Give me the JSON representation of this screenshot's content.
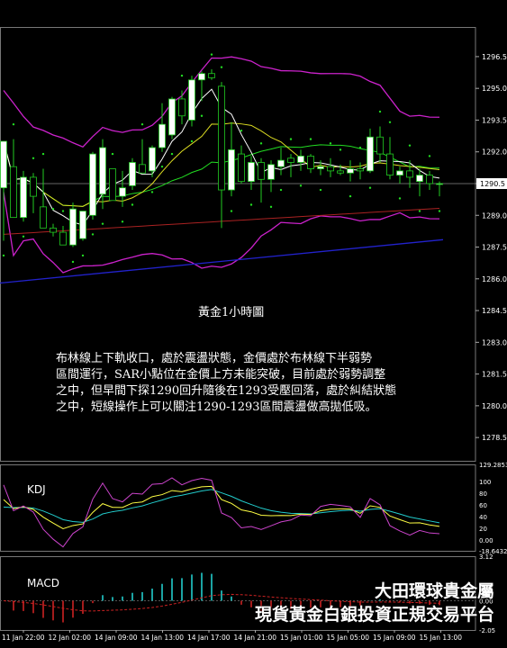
{
  "chart_data": [
    {
      "type": "candlestick",
      "title": "黃金1小時圖",
      "y_ticks": [
        1296.5,
        1295.0,
        1293.5,
        1292.0,
        1290.5,
        1289.0,
        1287.5,
        1286.0,
        1284.5,
        1283.0,
        1281.5,
        1280.0,
        1278.5
      ],
      "ylim": [
        1277.4,
        1297.9
      ],
      "current_price": "1290.5",
      "x_labels": [
        "11 Jan 22:00",
        "12 Jan 02:00",
        "14 Jan 09:00",
        "14 Jan 13:00",
        "14 Jan 17:00",
        "14 Jan 21:00",
        "15 Jan 01:00",
        "15 Jan 05:00",
        "15 Jan 09:00",
        "15 Jan 13:00"
      ],
      "candles": [
        {
          "o": 1290.3,
          "h": 1292.2,
          "l": 1287.8,
          "c": 1292.5
        },
        {
          "o": 1291.3,
          "h": 1292.6,
          "l": 1288.9,
          "c": 1288.9
        },
        {
          "o": 1288.9,
          "h": 1291.1,
          "l": 1288.7,
          "c": 1290.8
        },
        {
          "o": 1290.8,
          "h": 1291.0,
          "l": 1289.1,
          "c": 1289.9
        },
        {
          "o": 1289.4,
          "h": 1291.2,
          "l": 1288.4,
          "c": 1288.4
        },
        {
          "o": 1288.4,
          "h": 1288.6,
          "l": 1288.0,
          "c": 1288.2
        },
        {
          "o": 1288.2,
          "h": 1288.5,
          "l": 1287.6,
          "c": 1287.6
        },
        {
          "o": 1287.6,
          "h": 1289.6,
          "l": 1287.5,
          "c": 1289.3
        },
        {
          "o": 1287.9,
          "h": 1289.1,
          "l": 1287.8,
          "c": 1289.2
        },
        {
          "o": 1289.0,
          "h": 1292.0,
          "l": 1288.8,
          "c": 1291.9
        },
        {
          "o": 1290.0,
          "h": 1292.6,
          "l": 1289.3,
          "c": 1292.2
        },
        {
          "o": 1291.2,
          "h": 1291.2,
          "l": 1289.7,
          "c": 1289.7
        },
        {
          "o": 1289.9,
          "h": 1291.1,
          "l": 1289.4,
          "c": 1290.3
        },
        {
          "o": 1290.4,
          "h": 1291.7,
          "l": 1290.2,
          "c": 1291.5
        },
        {
          "o": 1291.4,
          "h": 1292.6,
          "l": 1291.0,
          "c": 1291.0
        },
        {
          "o": 1291.1,
          "h": 1292.3,
          "l": 1290.8,
          "c": 1292.2
        },
        {
          "o": 1292.2,
          "h": 1294.3,
          "l": 1292.0,
          "c": 1293.3
        },
        {
          "o": 1292.8,
          "h": 1294.6,
          "l": 1292.6,
          "c": 1294.5
        },
        {
          "o": 1294.5,
          "h": 1294.9,
          "l": 1293.3,
          "c": 1293.7
        },
        {
          "o": 1293.5,
          "h": 1295.6,
          "l": 1293.2,
          "c": 1295.4
        },
        {
          "o": 1295.4,
          "h": 1295.8,
          "l": 1294.4,
          "c": 1295.7
        },
        {
          "o": 1295.7,
          "h": 1295.9,
          "l": 1295.4,
          "c": 1295.5
        },
        {
          "o": 1295.1,
          "h": 1295.3,
          "l": 1288.4,
          "c": 1290.2
        },
        {
          "o": 1290.2,
          "h": 1293.4,
          "l": 1289.9,
          "c": 1292.1
        },
        {
          "o": 1291.9,
          "h": 1292.3,
          "l": 1290.5,
          "c": 1290.6
        },
        {
          "o": 1290.6,
          "h": 1291.8,
          "l": 1290.2,
          "c": 1291.5
        },
        {
          "o": 1291.5,
          "h": 1291.7,
          "l": 1289.6,
          "c": 1290.7
        },
        {
          "o": 1290.7,
          "h": 1291.6,
          "l": 1290.1,
          "c": 1291.4
        },
        {
          "o": 1291.3,
          "h": 1292.2,
          "l": 1290.9,
          "c": 1291.6
        },
        {
          "o": 1291.7,
          "h": 1291.9,
          "l": 1290.8,
          "c": 1291.5
        },
        {
          "o": 1291.5,
          "h": 1292.1,
          "l": 1291.1,
          "c": 1291.8
        },
        {
          "o": 1291.8,
          "h": 1291.9,
          "l": 1291.0,
          "c": 1291.2
        },
        {
          "o": 1291.2,
          "h": 1291.6,
          "l": 1290.9,
          "c": 1291.3
        },
        {
          "o": 1291.3,
          "h": 1291.7,
          "l": 1290.8,
          "c": 1291.1
        },
        {
          "o": 1291.1,
          "h": 1291.4,
          "l": 1290.9,
          "c": 1291.0
        },
        {
          "o": 1291.0,
          "h": 1291.6,
          "l": 1290.6,
          "c": 1291.2
        },
        {
          "o": 1291.2,
          "h": 1291.5,
          "l": 1290.7,
          "c": 1291.1
        },
        {
          "o": 1291.1,
          "h": 1293.1,
          "l": 1291.0,
          "c": 1292.7
        },
        {
          "o": 1292.7,
          "h": 1293.2,
          "l": 1291.5,
          "c": 1291.9
        },
        {
          "o": 1291.9,
          "h": 1292.7,
          "l": 1290.7,
          "c": 1290.9
        },
        {
          "o": 1290.9,
          "h": 1291.3,
          "l": 1290.5,
          "c": 1291.1
        },
        {
          "o": 1291.1,
          "h": 1291.6,
          "l": 1290.3,
          "c": 1290.8
        },
        {
          "o": 1290.6,
          "h": 1291.2,
          "l": 1289.9,
          "c": 1290.9
        },
        {
          "o": 1290.9,
          "h": 1291.1,
          "l": 1290.2,
          "c": 1290.5
        },
        {
          "o": 1290.5,
          "h": 1290.6,
          "l": 1289.9,
          "c": 1290.5
        }
      ],
      "colors": {
        "bull": "#ffffff",
        "bear": "#000000",
        "wick": "#22cc22",
        "boll": "#cc22cc",
        "ma_fast": "#ffffff",
        "ma_slow": "#dddd22",
        "ma_mid": "#22dd22",
        "ma_long": "#aa2222",
        "trend": "#2222cc",
        "sar": "#22dd22",
        "grid": "#444444"
      }
    },
    {
      "type": "line",
      "title": "KDJ",
      "y_ticks": [
        "129.2853",
        "100",
        "80",
        "60",
        "40",
        "20",
        "0.00",
        "-18.6432"
      ],
      "ylim": [
        -18.6432,
        129.2853
      ]
    },
    {
      "type": "bar",
      "title": "MACD",
      "y_ticks": [
        "3.12",
        "0.00",
        "-2.05"
      ],
      "ylim": [
        -2.05,
        3.12
      ]
    }
  ],
  "commentary": [
    "布林線上下軌收口，處於震盪狀態，金價處於布林線下半弱勢",
    "區間運行，SAR小點位在金價上方未能突破，目前處於弱勢調整",
    "之中，但早間下探1290回升隨後在1293受壓回落，處於糾結狀態",
    "之中，短線操作上可以關注1290-1293區間震盪做高拋低吸。"
  ],
  "brand": {
    "line1": "大田環球貴金屬",
    "line2": "現貨黃金白銀投資正規交易平台"
  }
}
